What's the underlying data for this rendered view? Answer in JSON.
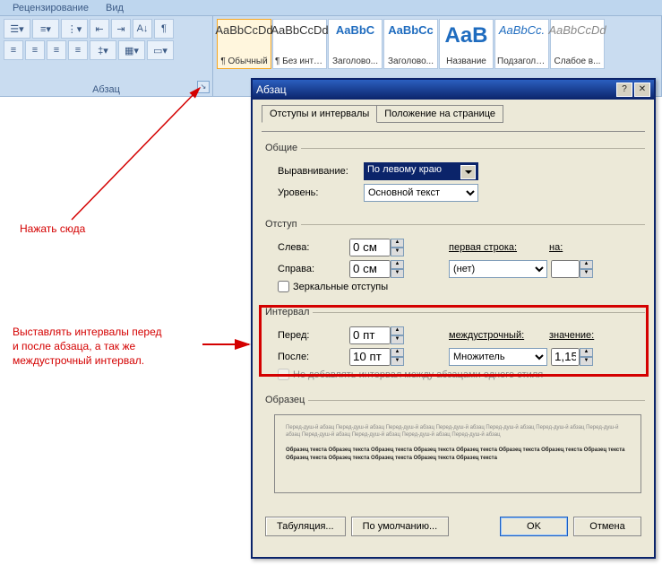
{
  "ribbon": {
    "tabs": [
      "Рецензирование",
      "Вид"
    ],
    "paragraph_group_label": "Абзац",
    "styles": [
      {
        "sample": "AaBbCcDd",
        "name": "¶ Обычный",
        "cls": ""
      },
      {
        "sample": "AaBbCcDd",
        "name": "¶ Без инте...",
        "cls": ""
      },
      {
        "sample": "AaBbC",
        "name": "Заголово...",
        "cls": "blue"
      },
      {
        "sample": "AaBbCc",
        "name": "Заголово...",
        "cls": "blue"
      },
      {
        "sample": "AaB",
        "name": "Название",
        "cls": "big"
      },
      {
        "sample": "AaBbCc.",
        "name": "Подзаголо...",
        "cls": "italic"
      },
      {
        "sample": "AaBbCcDd",
        "name": "Слабое в...",
        "cls": "gray"
      }
    ]
  },
  "annotations": {
    "click_here": "Нажать сюда",
    "interval_note_l1": "Выставлять интервалы перед",
    "interval_note_l2": "и после абзаца, а так же",
    "interval_note_l3": "междустрочный интервал."
  },
  "dialog": {
    "title": "Абзац",
    "tabs": {
      "indents": "Отступы и интервалы",
      "position": "Положение на странице"
    },
    "general": {
      "legend": "Общие",
      "align_label": "Выравнивание:",
      "align_value": "По левому краю",
      "level_label": "Уровень:",
      "level_value": "Основной текст"
    },
    "indent": {
      "legend": "Отступ",
      "left_label": "Слева:",
      "left_value": "0 см",
      "right_label": "Справа:",
      "right_value": "0 см",
      "first_line_label": "первая строка:",
      "first_line_value": "(нет)",
      "on_label": "на:",
      "on_value": "",
      "mirror": "Зеркальные отступы"
    },
    "interval": {
      "legend": "Интервал",
      "before_label": "Перед:",
      "before_value": "0 пт",
      "after_label": "После:",
      "after_value": "10 пт",
      "line_label": "междустрочный:",
      "line_value": "Множитель",
      "value_label": "значение:",
      "value_value": "1,15",
      "no_space": "Не добавлять интервал между абзацами одного стиля"
    },
    "sample": {
      "legend": "Образец",
      "grey1": "Перед-душ-й абзац Перед-душ-й абзац Перед-душ-й абзац Перед-душ-й абзац Перед-душ-й абзац Перед-душ-й абзац Перед-душ-й абзац Перед-душ-й абзац Перед-душ-й абзац Перед-душ-й абзац Перед-душ-й абзац",
      "bold": "Образец текста Образец текста Образец текста Образец текста Образец текста Образец текста Образец текста Образец текста Образец текста Образец текста Образец текста Образец текста Образец текста"
    },
    "buttons": {
      "tabs": "Табуляция...",
      "default": "По умолчанию...",
      "ok": "OK",
      "cancel": "Отмена"
    }
  }
}
